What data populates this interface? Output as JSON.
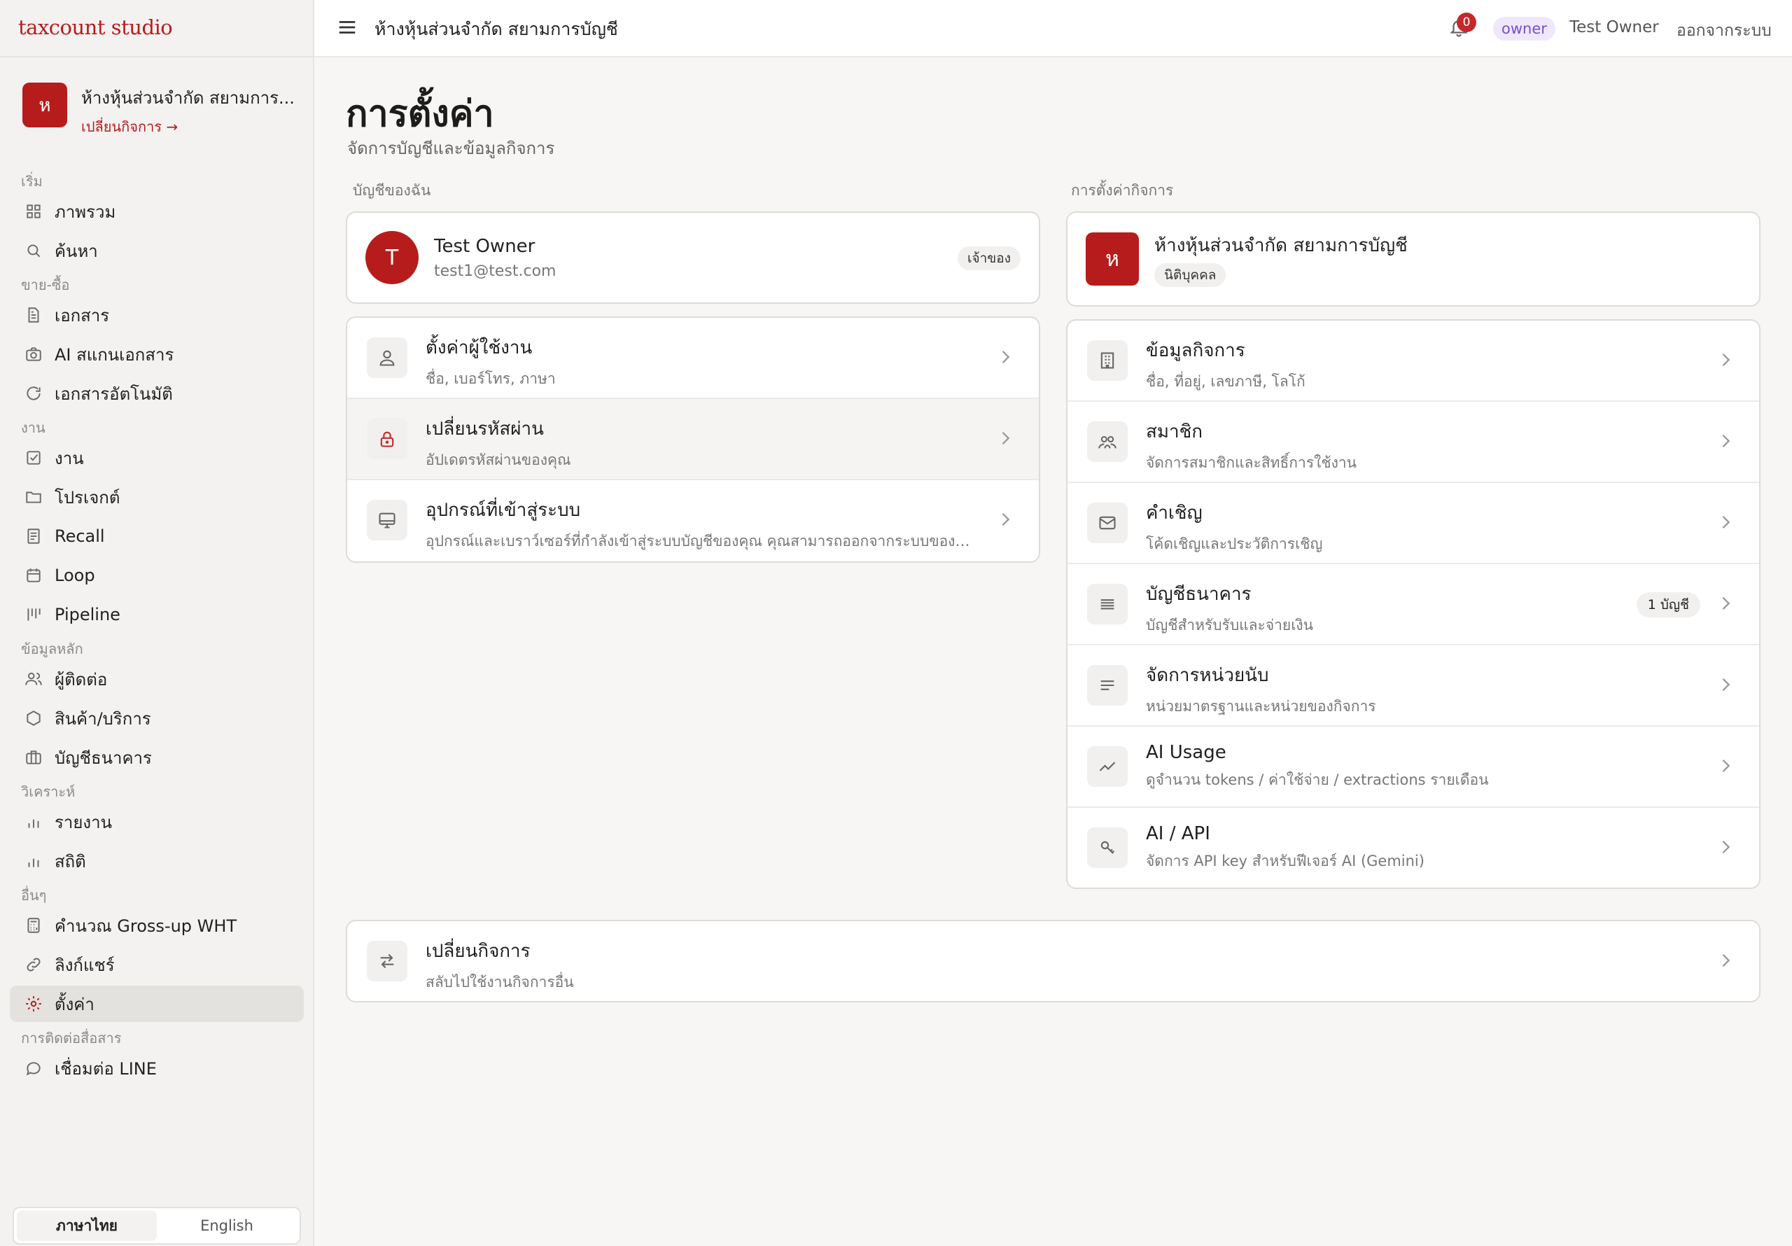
{
  "brand": "taxcount studio",
  "business": {
    "initial": "ห",
    "name": "ห้างหุ้นส่วนจำกัด สยามการ...",
    "switch_label": "เปลี่ยนกิจการ →"
  },
  "sidebar": {
    "sections": [
      {
        "label": "เริ่ม",
        "items": [
          {
            "label": "ภาพรวม",
            "icon": "grid-icon"
          },
          {
            "label": "ค้นหา",
            "icon": "search-icon"
          }
        ]
      },
      {
        "label": "ขาย-ซื้อ",
        "items": [
          {
            "label": "เอกสาร",
            "icon": "document-icon"
          },
          {
            "label": "AI สแกนเอกสาร",
            "icon": "camera-icon"
          },
          {
            "label": "เอกสารอัตโนมัติ",
            "icon": "refresh-icon"
          }
        ]
      },
      {
        "label": "งาน",
        "items": [
          {
            "label": "งาน",
            "icon": "checkbox-icon"
          },
          {
            "label": "โปรเจกต์",
            "icon": "folder-icon"
          },
          {
            "label": "Recall",
            "icon": "note-icon"
          },
          {
            "label": "Loop",
            "icon": "calendar-icon"
          },
          {
            "label": "Pipeline",
            "icon": "kanban-icon"
          }
        ]
      },
      {
        "label": "ข้อมูลหลัก",
        "items": [
          {
            "label": "ผู้ติดต่อ",
            "icon": "users-icon"
          },
          {
            "label": "สินค้า/บริการ",
            "icon": "box-icon"
          },
          {
            "label": "บัญชีธนาคาร",
            "icon": "briefcase-icon"
          }
        ]
      },
      {
        "label": "วิเคราะห์",
        "items": [
          {
            "label": "รายงาน",
            "icon": "bar-chart-icon"
          },
          {
            "label": "สถิติ",
            "icon": "bar-chart-icon"
          }
        ]
      },
      {
        "label": "อื่นๆ",
        "items": [
          {
            "label": "คำนวณ Gross-up WHT",
            "icon": "calculator-icon"
          },
          {
            "label": "ลิงก์แชร์",
            "icon": "link-icon"
          },
          {
            "label": "ตั้งค่า",
            "icon": "gear-icon",
            "active": true
          }
        ]
      },
      {
        "label": "การติดต่อสื่อสาร",
        "items": [
          {
            "label": "เชื่อมต่อ LINE",
            "icon": "chat-icon"
          }
        ]
      }
    ]
  },
  "language": {
    "thai": "ภาษาไทย",
    "english": "English",
    "selected": "ภาษาไทย"
  },
  "topbar": {
    "title": "ห้างหุ้นส่วนจำกัด สยามการบัญชี",
    "notification_count": "0",
    "role": "owner",
    "user": "Test Owner",
    "logout": "ออกจากระบบ"
  },
  "page": {
    "title": "การตั้งค่า",
    "subtitle": "จัดการบัญชีและข้อมูลกิจการ"
  },
  "my_account": {
    "section_label": "บัญชีของฉัน",
    "profile": {
      "initial": "T",
      "name": "Test Owner",
      "email": "test1@test.com",
      "role_badge": "เจ้าของ"
    },
    "rows": [
      {
        "title": "ตั้งค่าผู้ใช้งาน",
        "subtitle": "ชื่อ, เบอร์โทร, ภาษา",
        "icon": "user-icon"
      },
      {
        "title": "เปลี่ยนรหัสผ่าน",
        "subtitle": "อัปเดตรหัสผ่านของคุณ",
        "icon": "lock-icon"
      },
      {
        "title": "อุปกรณ์ที่เข้าสู่ระบบ",
        "subtitle": "อุปกรณ์และเบราว์เซอร์ที่กำลังเข้าสู่ระบบบัญชีของคุณ คุณสามารถออกจากระบบของอุ...",
        "icon": "monitor-icon"
      }
    ]
  },
  "business_settings": {
    "section_label": "การตั้งค่ากิจการ",
    "card": {
      "initial": "ห",
      "name": "ห้างหุ้นส่วนจำกัด สยามการบัญชี",
      "type_badge": "นิติบุคคล"
    },
    "rows": [
      {
        "title": "ข้อมูลกิจการ",
        "subtitle": "ชื่อ, ที่อยู่, เลขภาษี, โลโก้",
        "icon": "building-icon"
      },
      {
        "title": "สมาชิก",
        "subtitle": "จัดการสมาชิกและสิทธิ์การใช้งาน",
        "icon": "members-icon"
      },
      {
        "title": "คำเชิญ",
        "subtitle": "โค้ดเชิญและประวัติการเชิญ",
        "icon": "mail-icon"
      },
      {
        "title": "บัญชีธนาคาร",
        "subtitle": "บัญชีสำหรับรับและจ่ายเงิน",
        "icon": "lines-icon",
        "badge": "1 บัญชี"
      },
      {
        "title": "จัดการหน่วยนับ",
        "subtitle": "หน่วยมาตรฐานและหน่วยของกิจการ",
        "icon": "list-icon"
      },
      {
        "title": "AI Usage",
        "subtitle": "ดูจำนวน tokens / ค่าใช้จ่าย / extractions รายเดือน",
        "icon": "trend-icon"
      },
      {
        "title": "AI / API",
        "subtitle": "จัดการ API key สำหรับฟีเจอร์ AI (Gemini)",
        "icon": "key-icon"
      }
    ]
  },
  "switch_business": {
    "title": "เปลี่ยนกิจการ",
    "subtitle": "สลับไปใช้งานกิจการอื่น",
    "icon": "swap-icon"
  },
  "colors": {
    "accent": "#b71c1c",
    "role_badge_bg": "#efe7fb",
    "role_badge_text": "#7a4fc9"
  }
}
